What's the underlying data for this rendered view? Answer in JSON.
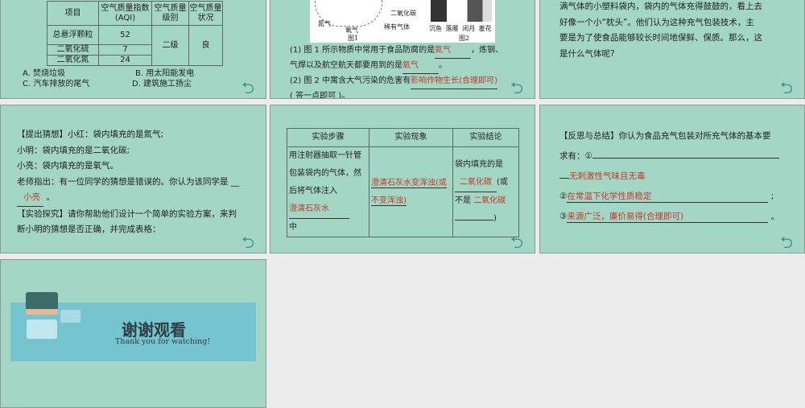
{
  "slide1": {
    "headers": [
      "项目",
      "空气质量指数 (AQI)",
      "空气质量级别",
      "空气质量状况"
    ],
    "rows": [
      {
        "item": "总悬浮颗粒",
        "aqi": "52"
      },
      {
        "item": "二氧化硫",
        "aqi": "7"
      },
      {
        "item": "二氧化氮",
        "aqi": "24"
      }
    ],
    "level": "二级",
    "status": "良",
    "options": [
      "A. 焚烧垃圾",
      "B. 用太阳能发电",
      "C. 汽车排放的尾气",
      "D. 建筑施工扬尘"
    ]
  },
  "slide2": {
    "fig1_labels": [
      "二氧化碳",
      "氮气",
      "氧气",
      "稀有气体"
    ],
    "fig1_caption": "图1",
    "fig2_labels": [
      "沉鱼",
      "落雁",
      "闭月",
      "羞花"
    ],
    "fig2_caption": "图2",
    "q1_a": "(1) 图 1 所示物质中常用于食品防腐的是",
    "ans1": "氮气",
    "q1_b": "，炼钢、",
    "q1_c": "气焊以及航空航天都要用到的是",
    "ans2": "氧气",
    "q1_end": "。",
    "q2_a": "(2) 图 2 中寓含大气污染的危害有",
    "ans3": "影响作物生长(合理即可)",
    "q2_b": "( 答一点即可 )。"
  },
  "slide3": {
    "lines": [
      "满气体的小塑料袋内，袋内的气体充得鼓鼓的，看上去",
      "好像一个小“枕头”。他们认为这种充气包装技术，主",
      "要是为了使食品能够较长时间地保鲜、保质。那么，这",
      "是什么气体呢?"
    ]
  },
  "slide4": {
    "lines": [
      "【提出猜想】小红：袋内填充的是氮气;",
      "小明：袋内填充的是二氧化碳;",
      "小亮：袋内填充的是氧气。",
      "老师指出：有一位同学的猜想是错误的。你认为该同学是 __"
    ],
    "answer": "小亮",
    "answer_end": "。",
    "lines2": [
      "【实验探究】请你帮助他们设计一个简单的实验方案，来判",
      "断小明的猜想是否正确，并完成表格："
    ]
  },
  "slide5": {
    "headers": [
      "实验步骤",
      "实验现象",
      "实验结论"
    ],
    "step": "用注射器抽取一针管包装袋内的气体，然后将气体注入",
    "step_ans": "澄清石灰水",
    "step_end": "中",
    "phenomenon": "澄清石灰水变浑浊(或不变浑浊)",
    "concl_a": "袋内填充的是",
    "concl_ans1": "二氧化碳",
    "concl_b": "(或",
    "concl_c": "不是",
    "concl_ans2": "二氧化碳",
    "concl_end": ")"
  },
  "slide6": {
    "line1": "【反思与总结】你认为食品充气包装对所充气体的基本要",
    "line2": "求有：①",
    "ans1": "无刺激性气味且无毒",
    "n2": "②",
    "ans2": "在常温下化学性质稳定",
    "sep2": ";",
    "n3": "③",
    "ans3": "来源广泛，廉价易得(合理即可)",
    "end3": "。"
  },
  "slide7": {
    "title": "谢谢观看",
    "subtitle": "Thank you for watching!"
  },
  "back_icon": "undo-arrow-icon"
}
